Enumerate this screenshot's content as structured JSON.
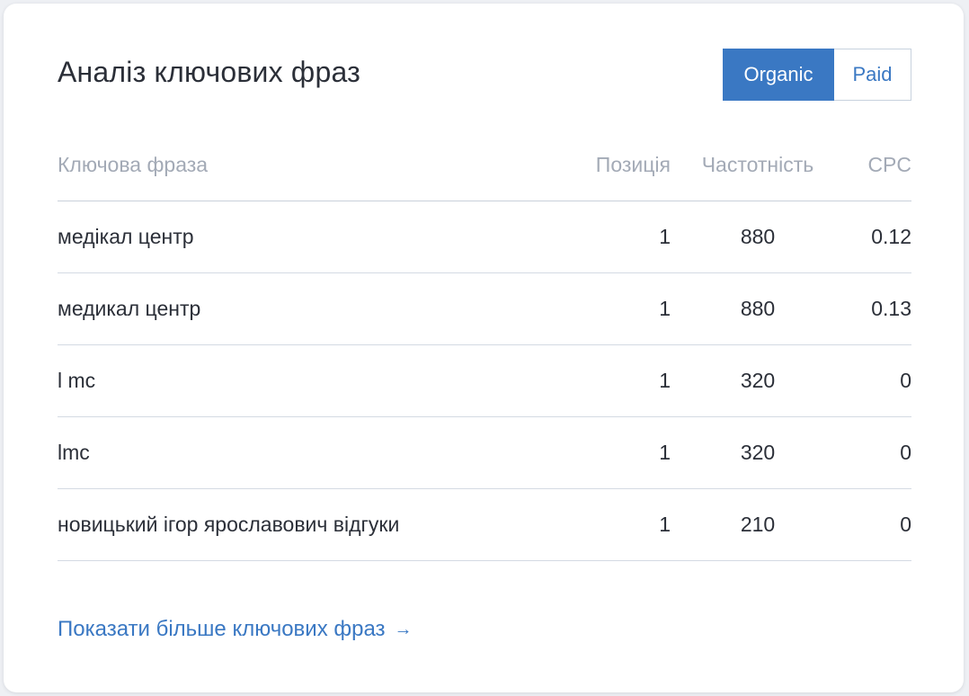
{
  "card": {
    "title": "Аналіз ключових фраз",
    "toggle": {
      "organic_label": "Organic",
      "paid_label": "Paid",
      "selected": "Organic"
    }
  },
  "table": {
    "columns": {
      "phrase": "Ключова фраза",
      "position": "Позиція",
      "frequency": "Частотність",
      "cpc": "CPC"
    },
    "rows": [
      {
        "phrase": "медікал центр",
        "position": "1",
        "frequency": "880",
        "cpc": "0.12"
      },
      {
        "phrase": "медикал центр",
        "position": "1",
        "frequency": "880",
        "cpc": "0.13"
      },
      {
        "phrase": "l mc",
        "position": "1",
        "frequency": "320",
        "cpc": "0"
      },
      {
        "phrase": "lmc",
        "position": "1",
        "frequency": "320",
        "cpc": "0"
      },
      {
        "phrase": "новицький ігор ярославович відгуки",
        "position": "1",
        "frequency": "210",
        "cpc": "0"
      }
    ]
  },
  "footer": {
    "more_link_label": "Показати більше ключових фраз",
    "arrow_icon": "→"
  },
  "colors": {
    "accent": "#3a78c3",
    "text": "#2b2f38",
    "muted": "#a3aab6",
    "divider": "#d4dae3"
  }
}
